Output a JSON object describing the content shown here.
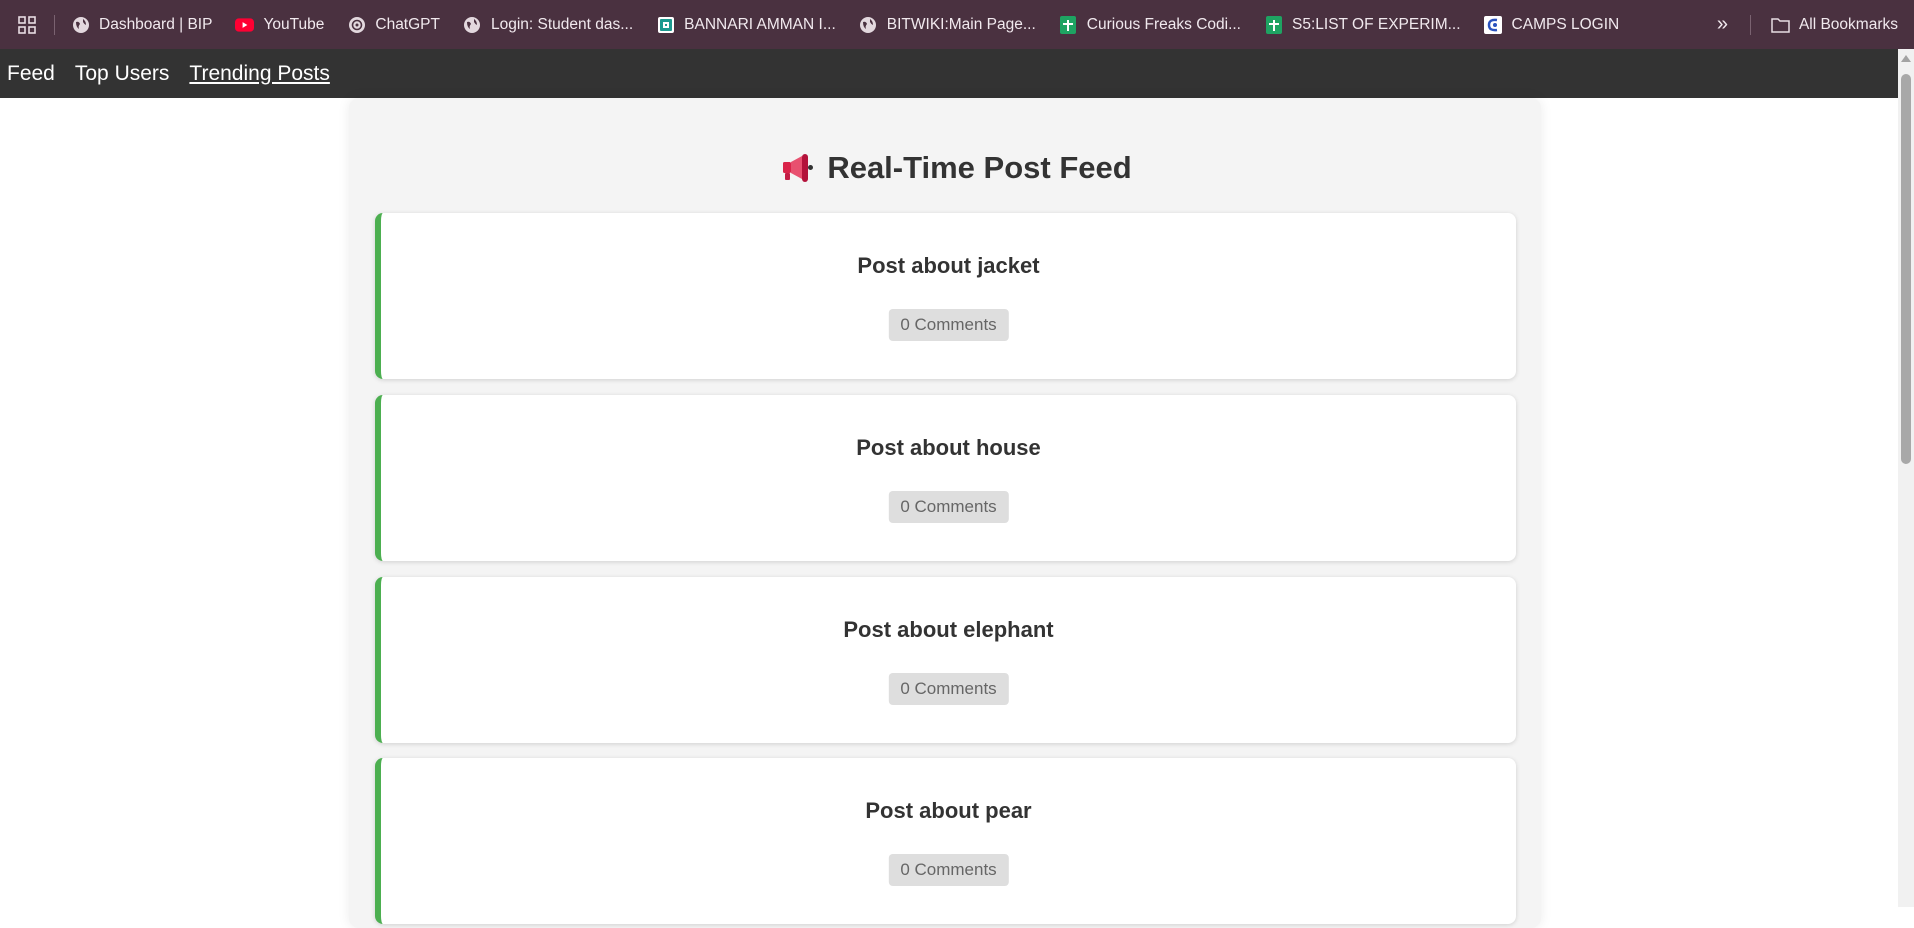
{
  "bookmarks": {
    "items": [
      {
        "label": "Dashboard | BIP",
        "icon": "globe-icon"
      },
      {
        "label": "YouTube",
        "icon": "youtube-icon"
      },
      {
        "label": "ChatGPT",
        "icon": "chatgpt-icon"
      },
      {
        "label": "Login:  Student das...",
        "icon": "globe-icon"
      },
      {
        "label": "BANNARI AMMAN I...",
        "icon": "bannari-icon"
      },
      {
        "label": "BITWIKI:Main Page...",
        "icon": "globe-icon"
      },
      {
        "label": "Curious Freaks Codi...",
        "icon": "sheets-icon"
      },
      {
        "label": "S5:LIST OF EXPERIM...",
        "icon": "sheets-icon"
      },
      {
        "label": "CAMPS LOGIN",
        "icon": "camps-icon"
      }
    ],
    "more": "»",
    "all_bookmarks": "All Bookmarks"
  },
  "nav": {
    "feed": "Feed",
    "top_users": "Top Users",
    "trending_posts": "Trending Posts"
  },
  "page": {
    "title": "Real-Time Post Feed"
  },
  "posts": [
    {
      "title": "Post about jacket",
      "comments": "0 Comments"
    },
    {
      "title": "Post about house",
      "comments": "0 Comments"
    },
    {
      "title": "Post about elephant",
      "comments": "0 Comments"
    },
    {
      "title": "Post about pear",
      "comments": "0 Comments"
    }
  ],
  "colors": {
    "bookmarks_bg": "#4a3140",
    "nav_bg": "#333333",
    "card_accent": "#4caf50",
    "container_bg": "#f4f4f4"
  }
}
